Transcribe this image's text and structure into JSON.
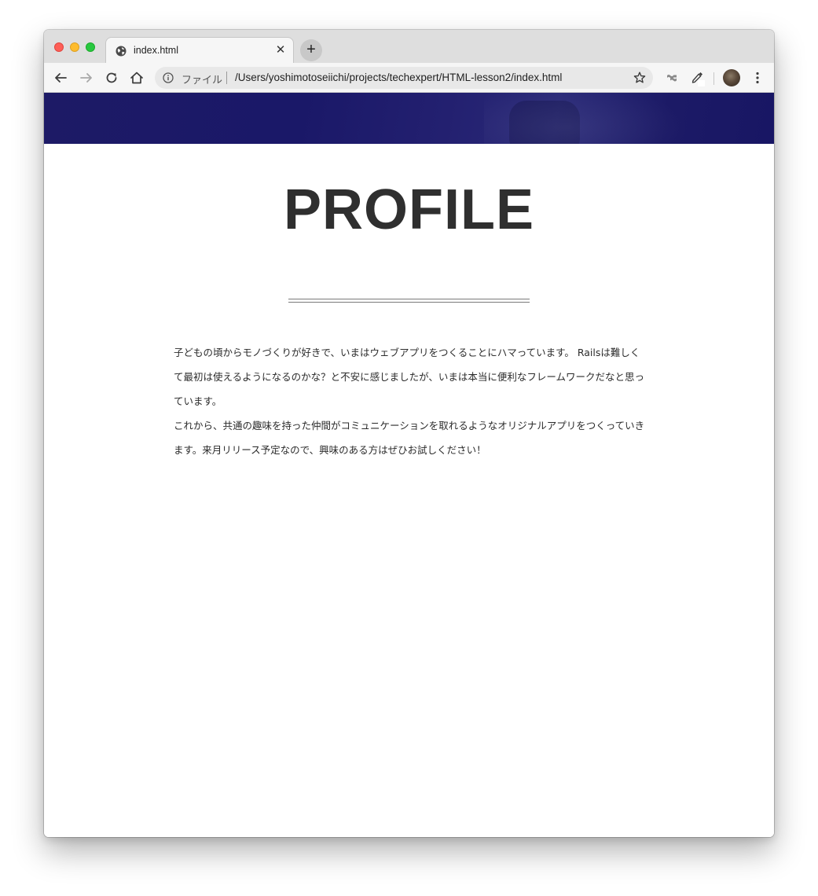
{
  "browser": {
    "tab": {
      "title": "index.html"
    },
    "new_tab_label": "+",
    "close_tab_label": "✕",
    "address_bar": {
      "scheme_label": "ファイル",
      "url": "/Users/yoshimotoseiichi/projects/techexpert/HTML-lesson2/index.html"
    }
  },
  "page": {
    "heading": "PROFILE",
    "paragraphs": [
      "子どもの頃からモノづくりが好きで、いまはウェブアプリをつくることにハマっています。 Railsは難しくて最初は使えるようになるのかな？と不安に感じましたが、いまは本当に便利なフレームワークだなと思っています。",
      "これから、共通の趣味を持った仲間がコミュニケーションを取れるようなオリジナルアプリをつくっていきます。来月リリース予定なので、興味のある方はぜひお試しください！"
    ]
  },
  "colors": {
    "hero_banner": "#1a1868",
    "heading_text": "#2f2f2f"
  },
  "icons": {
    "tab_favicon": "globe-icon",
    "back": "back-arrow-icon",
    "forward": "forward-arrow-icon",
    "reload": "reload-icon",
    "home": "home-icon",
    "site_info": "info-icon",
    "bookmark": "star-icon",
    "extension_1": "extension-icon",
    "extension_2": "eyedropper-icon",
    "profile": "avatar",
    "menu": "kebab-menu-icon"
  }
}
